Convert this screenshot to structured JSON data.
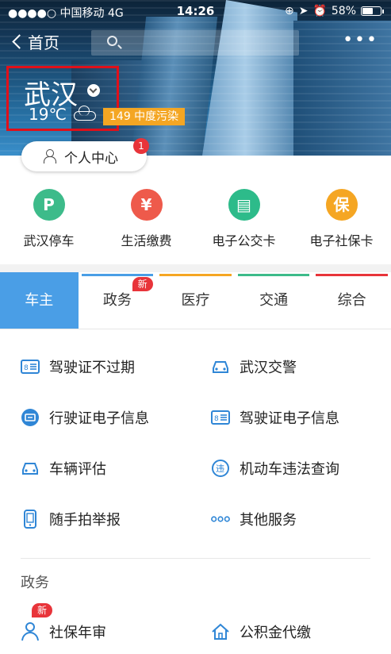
{
  "status_bar": {
    "carrier": "●●●●○ 中国移动  4G",
    "time": "14:26",
    "battery": "58%",
    "battery_level": 0.58
  },
  "nav": {
    "back_label": "首页",
    "more": "•••"
  },
  "weather": {
    "city": "武汉",
    "temp": "19℃",
    "aqi": "149 中度污染"
  },
  "personal_center": {
    "label": "个人中心",
    "badge": "1"
  },
  "quick_services": [
    {
      "label": "武汉停车",
      "icon": "parking-icon",
      "glyph": "P",
      "color": "#3dbb8a"
    },
    {
      "label": "生活缴费",
      "icon": "payment-icon",
      "glyph": "¥",
      "color": "#ee5a4b"
    },
    {
      "label": "电子公交卡",
      "icon": "bus-card-icon",
      "glyph": "▤",
      "color": "#2dbb8a"
    },
    {
      "label": "电子社保卡",
      "icon": "social-card-icon",
      "glyph": "保",
      "color": "#f5a623"
    }
  ],
  "tabs": [
    {
      "label": "车主",
      "active": true,
      "color": "#4a9ee6"
    },
    {
      "label": "政务",
      "new": "新",
      "color": "#4a9ee6"
    },
    {
      "label": "医疗",
      "color": "#f5a623"
    },
    {
      "label": "交通",
      "color": "#3dbb8a"
    },
    {
      "label": "综合",
      "color": "#e8343a"
    }
  ],
  "services": [
    {
      "label": "驾驶证不过期",
      "icon": "license-card-icon"
    },
    {
      "label": "武汉交警",
      "icon": "car-icon"
    },
    {
      "label": "行驶证电子信息",
      "icon": "vehicle-license-icon"
    },
    {
      "label": "驾驶证电子信息",
      "icon": "license-card-icon"
    },
    {
      "label": "车辆评估",
      "icon": "car-icon"
    },
    {
      "label": "机动车违法查询",
      "icon": "violation-icon"
    },
    {
      "label": "随手拍举报",
      "icon": "phone-icon"
    },
    {
      "label": "其他服务",
      "icon": "more-dots-icon"
    }
  ],
  "section_title": "政务",
  "gov_services": [
    {
      "label": "社保年审",
      "icon": "person-review-icon",
      "new": "新"
    },
    {
      "label": "公积金代缴",
      "icon": "home-icon"
    }
  ]
}
